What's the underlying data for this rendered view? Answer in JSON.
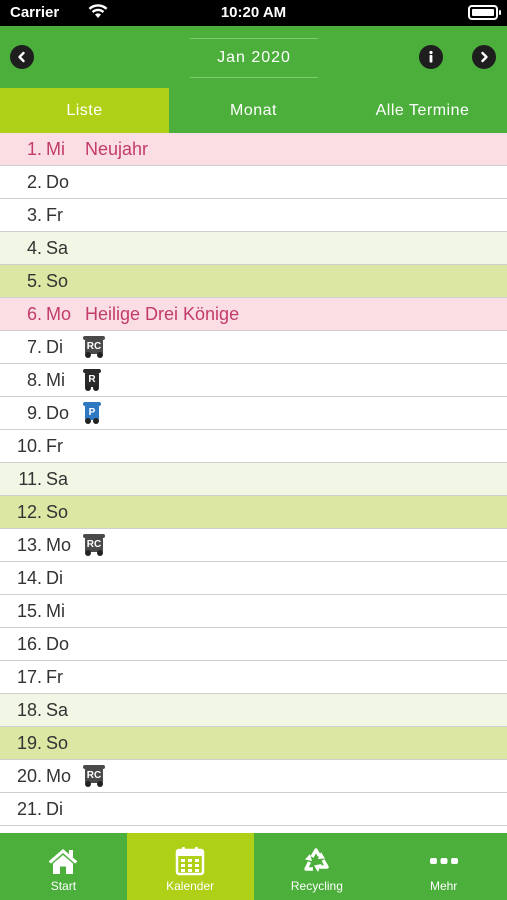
{
  "status_bar": {
    "carrier": "Carrier",
    "time": "10:20 AM"
  },
  "header": {
    "month_title": "Jan 2020"
  },
  "tabs": [
    {
      "label": "Liste",
      "active": true
    },
    {
      "label": "Monat",
      "active": false
    },
    {
      "label": "Alle Termine",
      "active": false
    }
  ],
  "days": [
    {
      "num": "1.",
      "name": "Mi",
      "type": "holiday",
      "holiday": "Neujahr"
    },
    {
      "num": "2.",
      "name": "Do",
      "type": "weekday"
    },
    {
      "num": "3.",
      "name": "Fr",
      "type": "weekday"
    },
    {
      "num": "4.",
      "name": "Sa",
      "type": "sat"
    },
    {
      "num": "5.",
      "name": "So",
      "type": "sun"
    },
    {
      "num": "6.",
      "name": "Mo",
      "type": "holiday",
      "holiday": "Heilige Drei Könige"
    },
    {
      "num": "7.",
      "name": "Di",
      "type": "weekday",
      "bin": {
        "kind": "rc",
        "label": "RC",
        "color": "#4a4a4a"
      }
    },
    {
      "num": "8.",
      "name": "Mi",
      "type": "weekday",
      "bin": {
        "kind": "r",
        "label": "R",
        "color": "#2a2a2a"
      }
    },
    {
      "num": "9.",
      "name": "Do",
      "type": "weekday",
      "bin": {
        "kind": "p",
        "label": "P",
        "color": "#2f79c2"
      }
    },
    {
      "num": "10.",
      "name": "Fr",
      "type": "weekday"
    },
    {
      "num": "11.",
      "name": "Sa",
      "type": "sat"
    },
    {
      "num": "12.",
      "name": "So",
      "type": "sun"
    },
    {
      "num": "13.",
      "name": "Mo",
      "type": "weekday",
      "bin": {
        "kind": "rc",
        "label": "RC",
        "color": "#4a4a4a"
      }
    },
    {
      "num": "14.",
      "name": "Di",
      "type": "weekday"
    },
    {
      "num": "15.",
      "name": "Mi",
      "type": "weekday"
    },
    {
      "num": "16.",
      "name": "Do",
      "type": "weekday"
    },
    {
      "num": "17.",
      "name": "Fr",
      "type": "weekday"
    },
    {
      "num": "18.",
      "name": "Sa",
      "type": "sat"
    },
    {
      "num": "19.",
      "name": "So",
      "type": "sun"
    },
    {
      "num": "20.",
      "name": "Mo",
      "type": "weekday",
      "bin": {
        "kind": "rc",
        "label": "RC",
        "color": "#4a4a4a"
      }
    },
    {
      "num": "21.",
      "name": "Di",
      "type": "weekday"
    }
  ],
  "tab_bar": [
    {
      "label": "Start",
      "icon": "home-icon",
      "active": false
    },
    {
      "label": "Kalender",
      "icon": "calendar-icon",
      "active": true
    },
    {
      "label": "Recycling",
      "icon": "recycling-icon",
      "active": false
    },
    {
      "label": "Mehr",
      "icon": "more-icon",
      "active": false
    }
  ],
  "colors": {
    "primary_green": "#4caf3c",
    "active_lime": "#aed016",
    "holiday_bg": "#fbdde4",
    "holiday_text": "#c23b6b",
    "saturday_bg": "#f2f6e4",
    "sunday_bg": "#dde7a4"
  }
}
